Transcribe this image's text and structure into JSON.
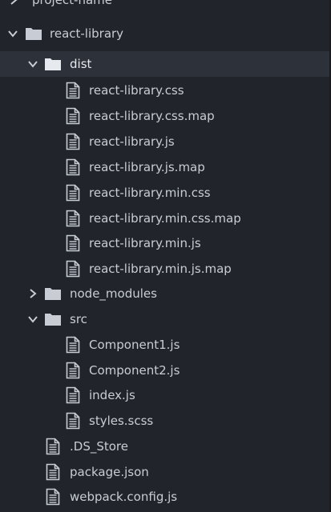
{
  "tree": {
    "clipped_label": "project-name",
    "root": {
      "label": "react-library"
    },
    "dist": {
      "label": "dist",
      "files": [
        "react-library.css",
        "react-library.css.map",
        "react-library.js",
        "react-library.js.map",
        "react-library.min.css",
        "react-library.min.css.map",
        "react-library.min.js",
        "react-library.min.js.map"
      ]
    },
    "node_modules": {
      "label": "node_modules"
    },
    "src": {
      "label": "src",
      "files": [
        "Component1.js",
        "Component2.js",
        "index.js",
        "styles.scss"
      ]
    },
    "root_files": [
      ".DS_Store",
      "package.json",
      "webpack.config.js"
    ]
  },
  "icons": {
    "folder": "folder-icon",
    "file": "file-text-icon",
    "expanded": "chevron-down-icon",
    "collapsed": "chevron-right-icon"
  },
  "colors": {
    "background": "#21252b",
    "selected_row": "#2c313a",
    "text": "#c8cdd5",
    "icon": "#c8cdd5"
  }
}
